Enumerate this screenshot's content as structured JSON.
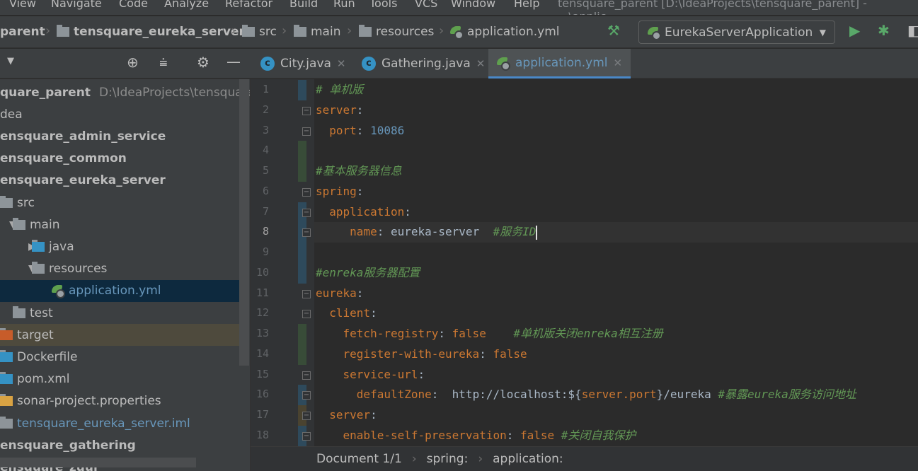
{
  "menu": [
    "View",
    "Navigate",
    "Code",
    "Analyze",
    "Refactor",
    "Build",
    "Run",
    "Tools",
    "VCS",
    "Window",
    "Help"
  ],
  "window_title": "tensquare_parent [D:\\IdeaProjects\\tensquare_parent] - ...\\applic",
  "breadcrumb": [
    "parent",
    "tensquare_eureka_server",
    "src",
    "main",
    "resources",
    "application.yml"
  ],
  "run_config": "EurekaServerApplication",
  "tabs": [
    {
      "label": "City.java",
      "active": false
    },
    {
      "label": "Gathering.java",
      "active": false
    },
    {
      "label": "application.yml",
      "active": true
    }
  ],
  "tree": [
    {
      "label": "quare_parent",
      "hint": "D:\\IdeaProjects\\tensquare_pa",
      "bold": true,
      "indent": 0
    },
    {
      "label": "dea",
      "indent": 0
    },
    {
      "label": "ensquare_admin_service",
      "bold": true,
      "indent": 0
    },
    {
      "label": "ensquare_common",
      "bold": true,
      "indent": 0
    },
    {
      "label": "ensquare_eureka_server",
      "bold": true,
      "indent": 0
    },
    {
      "label": "src",
      "indent": 1,
      "icon": "folder-icon"
    },
    {
      "label": "main",
      "indent": 2,
      "icon": "folder-icon",
      "arrow": "▼"
    },
    {
      "label": "java",
      "indent": 3,
      "icon": "source-folder-icon",
      "arrow": "▶"
    },
    {
      "label": "resources",
      "indent": 3,
      "icon": "resources-folder-icon",
      "arrow": "▼"
    },
    {
      "label": "application.yml",
      "indent": 4,
      "icon": "spring-icon",
      "selected": true
    },
    {
      "label": "test",
      "indent": 2,
      "icon": "folder-icon"
    },
    {
      "label": "target",
      "indent": 1,
      "icon": "excluded-folder-icon",
      "excluded": true
    },
    {
      "label": "Dockerfile",
      "indent": 1,
      "icon": "docker-file-icon"
    },
    {
      "label": "pom.xml",
      "indent": 1,
      "icon": "maven-icon"
    },
    {
      "label": "sonar-project.properties",
      "indent": 1,
      "icon": "properties-icon"
    },
    {
      "label": "tensquare_eureka_server.iml",
      "indent": 1,
      "icon": "iml-icon",
      "link": true
    },
    {
      "label": "ensquare_gathering",
      "bold": true,
      "indent": 0
    },
    {
      "label": "ensquare_zuul",
      "bold": true,
      "indent": 0
    }
  ],
  "code": [
    [
      [
        "c",
        "# 单机版"
      ]
    ],
    [
      [
        "k",
        "server"
      ],
      [
        "v",
        ":"
      ]
    ],
    [
      [
        "p",
        "  "
      ],
      [
        "k",
        "port"
      ],
      [
        "v",
        ": "
      ],
      [
        "n",
        "10086"
      ]
    ],
    [],
    [
      [
        "c",
        "#基本服务器信息"
      ]
    ],
    [
      [
        "k",
        "spring"
      ],
      [
        "v",
        ":"
      ]
    ],
    [
      [
        "p",
        "  "
      ],
      [
        "k",
        "application"
      ],
      [
        "v",
        ":"
      ]
    ],
    [
      [
        "p",
        "     "
      ],
      [
        "k",
        "name"
      ],
      [
        "v",
        ": eureka-server  "
      ],
      [
        "c",
        "#服务ID"
      ]
    ],
    [],
    [
      [
        "c",
        "#enreka服务器配置"
      ]
    ],
    [
      [
        "k",
        "eureka"
      ],
      [
        "v",
        ":"
      ]
    ],
    [
      [
        "p",
        "  "
      ],
      [
        "k",
        "client"
      ],
      [
        "v",
        ":"
      ]
    ],
    [
      [
        "p",
        "    "
      ],
      [
        "k",
        "fetch-registry"
      ],
      [
        "v",
        ": "
      ],
      [
        "k",
        "false"
      ],
      [
        "v",
        "    "
      ],
      [
        "c",
        "#单机版关闭enreka相互注册"
      ]
    ],
    [
      [
        "p",
        "    "
      ],
      [
        "k",
        "register-with-eureka"
      ],
      [
        "v",
        ": "
      ],
      [
        "k",
        "false"
      ]
    ],
    [
      [
        "p",
        "    "
      ],
      [
        "k",
        "service-url"
      ],
      [
        "v",
        ":"
      ]
    ],
    [
      [
        "p",
        "      "
      ],
      [
        "k",
        "defaultZone"
      ],
      [
        "v",
        ":  http://localhost:${"
      ],
      [
        "k",
        "server.port"
      ],
      [
        "v",
        "}/eureka "
      ],
      [
        "c",
        "#暴露eureka服务访问地址"
      ]
    ],
    [
      [
        "p",
        "  "
      ],
      [
        "k",
        "server"
      ],
      [
        "v",
        ":"
      ]
    ],
    [
      [
        "p",
        "    "
      ],
      [
        "k",
        "enable-self-preservation"
      ],
      [
        "v",
        ": "
      ],
      [
        "k",
        "false"
      ],
      [
        "v",
        " "
      ],
      [
        "c",
        "#关闭自我保护"
      ]
    ]
  ],
  "current_line": 8,
  "status": {
    "document": "Document 1/1",
    "path": [
      "spring:",
      "application:"
    ]
  },
  "colors": {
    "accent": "#4a88c7",
    "keyword": "#cc7832",
    "comment": "#629755",
    "number": "#6897bb"
  }
}
